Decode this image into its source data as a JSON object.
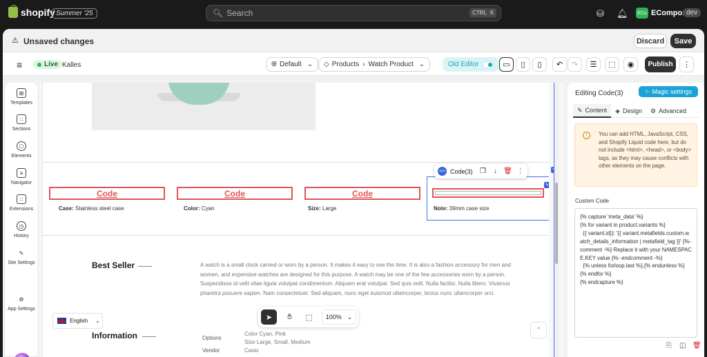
{
  "topbar": {
    "brand": "shopify",
    "edition": "Summer '25",
    "search_placeholder": "Search",
    "kbd_ctrl": "CTRL",
    "kbd_k": "K",
    "avatar_initials": "ECo",
    "store_name": "EComposer",
    "store_badge": "dev"
  },
  "savebar": {
    "message": "Unsaved changes",
    "discard": "Discard",
    "save": "Save"
  },
  "editor_toolbar": {
    "status": "Live",
    "theme": "Kalles",
    "language": "Default",
    "breadcrumb_root": "Products",
    "breadcrumb_page": "Watch Product",
    "old_editor": "Old Editor",
    "publish": "Publish"
  },
  "left_rail": {
    "items": [
      {
        "label": "Templates",
        "icon": "templates-icon"
      },
      {
        "label": "Sections",
        "icon": "sections-icon"
      },
      {
        "label": "Elements",
        "icon": "elements-icon"
      },
      {
        "label": "Navigator",
        "icon": "navigator-icon"
      },
      {
        "label": "Extensions",
        "icon": "extensions-icon"
      },
      {
        "label": "History",
        "icon": "history-icon"
      },
      {
        "label": "Site Settings",
        "icon": "brush-icon"
      },
      {
        "label": "App Settings",
        "icon": "gear-icon"
      }
    ]
  },
  "canvas": {
    "code_labels": [
      "Code",
      "Code",
      "Code"
    ],
    "attrs": [
      {
        "key": "Case:",
        "value": " Stainless steel case"
      },
      {
        "key": "Color:",
        "value": " Cyan"
      },
      {
        "key": "Size:",
        "value": " Large"
      },
      {
        "key": "Note:",
        "value": " 39mm case size"
      }
    ],
    "code_toolbar_label": "Code(3)",
    "best_seller": "Best Seller",
    "description": "A watch is a small clock carried or worn by a person. It makes it easy to see the time. It is also a fashion accessory for men and women, and expensive watches are designed for this purpose. A watch may be one of the few accessories worn by a person. Suspendisse id velit vitae ligula volutpat condimentum. Aliquam erat volutpat. Sed quis velit. Nulla facilisi. Nulla libero. Vivamus pharetra posuere sapien. Nam consectetuer. Sed aliquam, nunc eget euismod ullamcorper, lectus nunc ullamcorper orci.",
    "information": "Information",
    "options_label": "Options",
    "options_color": "Color Cyan, Pink",
    "options_size": "Size Large, Small, Medium",
    "vendor_label": "Vendor",
    "vendor_value": "Casio",
    "language": "English",
    "zoom": "100%"
  },
  "right_panel": {
    "title": "Editing Code(3)",
    "magic": "Magic settings",
    "tabs": [
      "Content",
      "Design",
      "Advanced"
    ],
    "notice": "You can add HTML, JavaScript, CSS, and Shopify Liquid code here, but do not include <html>, <head>, or <body> tags, as they may cause conflicts with other elements on the page.",
    "custom_code_label": "Custom Code",
    "code_lines": [
      "{% capture 'meta_data' %}",
      "{% for variant in product.variants %}",
      "  {{ variant.id}}: '{{ variant.metafields.custom.watch_details_information | metafield_tag }}' {%-comment -%} Replace it with your NAMESPACE.KEY value {%- endcomment -%}",
      "  {% unless forloop.last %},{% endunless %}",
      "{% endfor %}",
      "{% endcapture %}"
    ]
  },
  "colors": {
    "accent": "#1aa3d6",
    "danger_outline": "#e05454",
    "selection": "#4a6de5",
    "live_green": "#2fb457"
  }
}
